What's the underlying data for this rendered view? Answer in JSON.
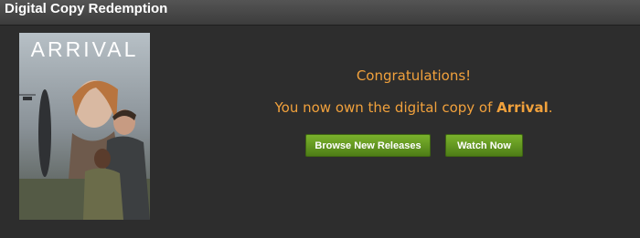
{
  "header": {
    "title": "Digital Copy Redemption"
  },
  "poster": {
    "title": "ARRIVAL"
  },
  "message": {
    "congrats": "Congratulations!",
    "owned_prefix": "You now own the digital copy of ",
    "movie_title": "Arrival",
    "owned_suffix": "."
  },
  "buttons": {
    "browse_label": "Browse New Releases",
    "watch_label": "Watch Now"
  },
  "colors": {
    "background": "#2d2d2d",
    "accent_text": "#f1a13c",
    "button_green": "#6aa325"
  }
}
